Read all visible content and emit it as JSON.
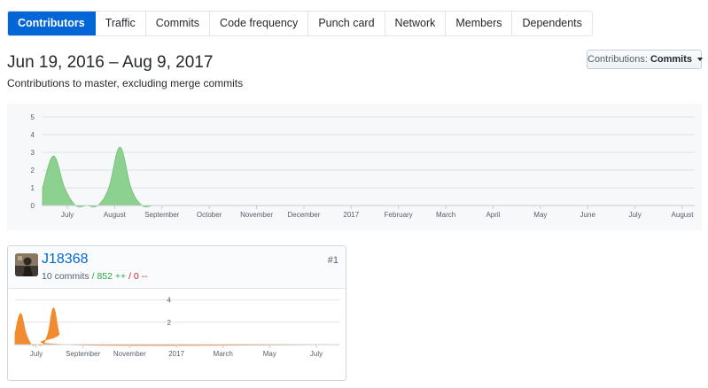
{
  "tabs": [
    {
      "label": "Contributors",
      "active": true
    },
    {
      "label": "Traffic",
      "active": false
    },
    {
      "label": "Commits",
      "active": false
    },
    {
      "label": "Code frequency",
      "active": false
    },
    {
      "label": "Punch card",
      "active": false
    },
    {
      "label": "Network",
      "active": false
    },
    {
      "label": "Members",
      "active": false
    },
    {
      "label": "Dependents",
      "active": false
    }
  ],
  "header": {
    "title": "Jun 19, 2016 – Aug 9, 2017",
    "subtitle": "Contributions to master, excluding merge commits"
  },
  "contributions_select": {
    "prefix": "Contributions:",
    "value": "Commits"
  },
  "colors": {
    "accent": "#0366d6",
    "main_area": "#8cd18f",
    "main_area_stroke": "#6cc070",
    "contributor_area": "#f28b30",
    "additions": "#28a745",
    "deletions": "#cb2431"
  },
  "chart_data": [
    {
      "type": "area",
      "title": "",
      "x_tick_labels": [
        "July",
        "August",
        "September",
        "October",
        "November",
        "December",
        "2017",
        "February",
        "March",
        "April",
        "May",
        "June",
        "July",
        "August"
      ],
      "y_tick_labels": [
        "0",
        "1",
        "2",
        "3",
        "4",
        "5"
      ],
      "ylim": [
        0,
        5
      ],
      "grid": true,
      "series": [
        {
          "x": [
            "2016-06-19",
            "2016-06-26",
            "2016-07-03",
            "2016-07-10",
            "2016-07-17",
            "2016-07-24",
            "2016-07-31",
            "2016-08-07",
            "2016-08-14",
            "2016-08-21",
            "2016-08-28",
            "2016-09-04",
            "2017-08-06"
          ],
          "values": [
            1,
            2.8,
            1,
            0,
            0,
            0,
            1,
            3.3,
            1,
            0,
            0,
            0,
            0
          ]
        }
      ]
    },
    {
      "type": "area",
      "title": "",
      "x_tick_labels": [
        "July",
        "September",
        "November",
        "2017",
        "March",
        "May",
        "July"
      ],
      "y_tick_labels": [
        "2",
        "4"
      ],
      "ylim": [
        0,
        5
      ],
      "grid": true,
      "series": [
        {
          "x": [
            "2016-06-19",
            "2016-06-26",
            "2016-07-03",
            "2016-07-10",
            "2016-07-17",
            "2016-07-24",
            "2016-07-31",
            "2016-08-07",
            "2016-08-14",
            "2016-08-21",
            "2017-08-06"
          ],
          "values": [
            1,
            2.8,
            1,
            0,
            0,
            0,
            1,
            3.3,
            1,
            0,
            0
          ]
        }
      ]
    }
  ],
  "contributor": {
    "username": "J18368",
    "commits": "10 commits",
    "separator1": "/",
    "additions": "852 ++",
    "separator2": "/",
    "deletions": "0 --",
    "rank": "#1",
    "avatar_icon": "user-avatar"
  }
}
